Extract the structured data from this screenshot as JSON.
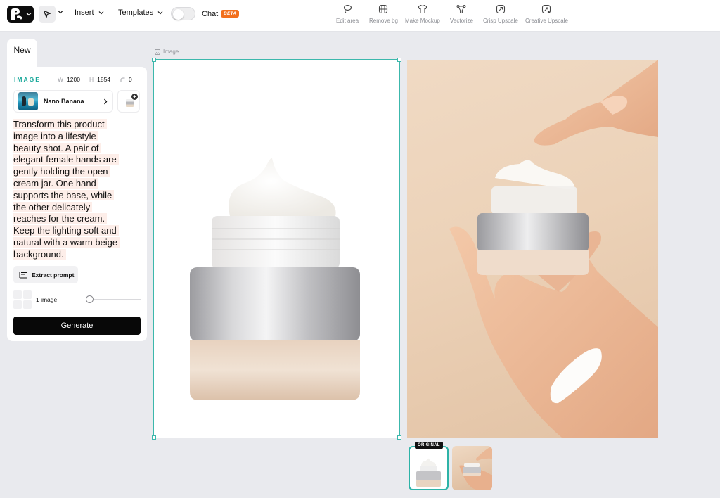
{
  "toolbar": {
    "insert_label": "Insert",
    "templates_label": "Templates",
    "chat_label": "Chat",
    "beta_label": "BETA",
    "tools": [
      {
        "label": "Edit area",
        "icon": "lasso-icon"
      },
      {
        "label": "Remove bg",
        "icon": "remove-bg-icon"
      },
      {
        "label": "Make Mockup",
        "icon": "tshirt-icon"
      },
      {
        "label": "Vectorize",
        "icon": "vector-nodes-icon"
      },
      {
        "label": "Crisp Upscale",
        "icon": "upscale-arrows-icon"
      },
      {
        "label": "Creative Upscale",
        "icon": "creative-upscale-icon"
      }
    ]
  },
  "panel": {
    "tab_label": "New",
    "section_label": "IMAGE",
    "width_key": "W",
    "width_value": "1200",
    "height_key": "H",
    "height_value": "1854",
    "corner_value": "0",
    "model_name": "Nano Banana",
    "prompt_lines": [
      "Transform this product",
      "image into a lifestyle",
      "beauty shot. A pair of",
      "elegant female hands are",
      "gently holding the open",
      "cream jar. One hand",
      "supports the base, while",
      "the other delicately",
      "reaches for the cream.",
      "Keep the lighting soft and",
      "natural with a warm beige",
      "background."
    ],
    "extract_label": "Extract prompt",
    "image_count_label": "1 image",
    "image_count": 1,
    "generate_label": "Generate"
  },
  "canvas": {
    "artboard_label": "Image",
    "original_badge": "ORIGINAL"
  },
  "colors": {
    "accent": "#3cb8ac",
    "section_label": "#19a89a",
    "beta": "#f26f1c",
    "prompt_highlight": "#fdeee9"
  }
}
